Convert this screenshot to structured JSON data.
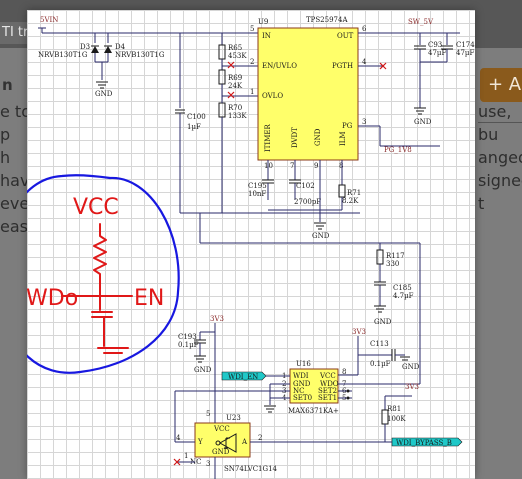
{
  "background": {
    "tab_label": "TI trai",
    "heading": "n",
    "left_lines": [
      "e to p",
      "h hav",
      "eveni",
      "ease"
    ],
    "right_lines": [
      "use, bu",
      "anged",
      "signed t"
    ],
    "add_button": "+ A"
  },
  "schematic": {
    "power_net": "5VIN",
    "output_net": "SW_5V",
    "diodes": [
      {
        "ref": "D3",
        "part": "NRVB130T1G"
      },
      {
        "ref": "D4",
        "part": "NRVB130T1G"
      }
    ],
    "u9": {
      "ref": "U9",
      "part": "TPS25974A",
      "pins": {
        "in": "IN",
        "out": "OUT",
        "en_uvlo": "EN/UVLO",
        "pgth": "PGTH",
        "ovlo": "OVLO",
        "pg": "PG",
        "itimer": "ITIMER",
        "dvdt": "DVDT",
        "gnd": "GND",
        "ilm": "ILM"
      },
      "pin_numbers": {
        "out": "6",
        "pgth": "4",
        "pg": "3",
        "in": "5",
        "en_uvlo": "2",
        "ovlo": "1",
        "itimer": "10",
        "dvdt": "7",
        "gnd": "9",
        "ilm": "8"
      }
    },
    "resistors": [
      {
        "ref": "R65",
        "value": "453K"
      },
      {
        "ref": "R69",
        "value": "24K"
      },
      {
        "ref": "R70",
        "value": "133K"
      },
      {
        "ref": "R71",
        "value": "8.2K"
      },
      {
        "ref": "R117",
        "value": "330"
      },
      {
        "ref": "R81",
        "value": "100K"
      }
    ],
    "capacitors": [
      {
        "ref": "C93",
        "value": "47µF"
      },
      {
        "ref": "C174",
        "value": "47µF"
      },
      {
        "ref": "C100",
        "value": "1µF"
      },
      {
        "ref": "C195",
        "value": "10nF"
      },
      {
        "ref": "C102",
        "value": "2700pF"
      },
      {
        "ref": "C185",
        "value": "4.7µF"
      },
      {
        "ref": "C193",
        "value": "0.1µF"
      },
      {
        "ref": "C113",
        "value": "0.1µF"
      }
    ],
    "pg_net": "PG_1V8",
    "gnd": "GND",
    "rail_3v3": "3V3",
    "u16": {
      "ref": "U16",
      "part": "MAX6371KA+",
      "pins": {
        "wdi": "WDI",
        "vcc": "VCC",
        "gnd": "GND",
        "wdo": "WDO",
        "nc": "NC",
        "set2": "SET2",
        "set0": "SET0",
        "set1": "SET1"
      },
      "pin_numbers": {
        "wdi": "1",
        "gnd": "2",
        "nc": "3",
        "set0": "4",
        "set1": "5",
        "set2": "6",
        "wdo": "7",
        "vcc": "8"
      }
    },
    "u23": {
      "ref": "U23",
      "part": "SN74LVC1G14",
      "pins": {
        "vcc": "VCC",
        "gnd": "GND",
        "y": "Y",
        "a": "A",
        "nc": "NC"
      },
      "pin_numbers": {
        "vcc": "5",
        "gnd": "3",
        "y": "4",
        "a": "2",
        "nc": "1"
      }
    },
    "net_flags": [
      "WDI_EN",
      "WDI_BYPASS_B"
    ]
  },
  "annotation": {
    "vcc": "VCC",
    "wdo": "WDo",
    "en": "EN"
  }
}
